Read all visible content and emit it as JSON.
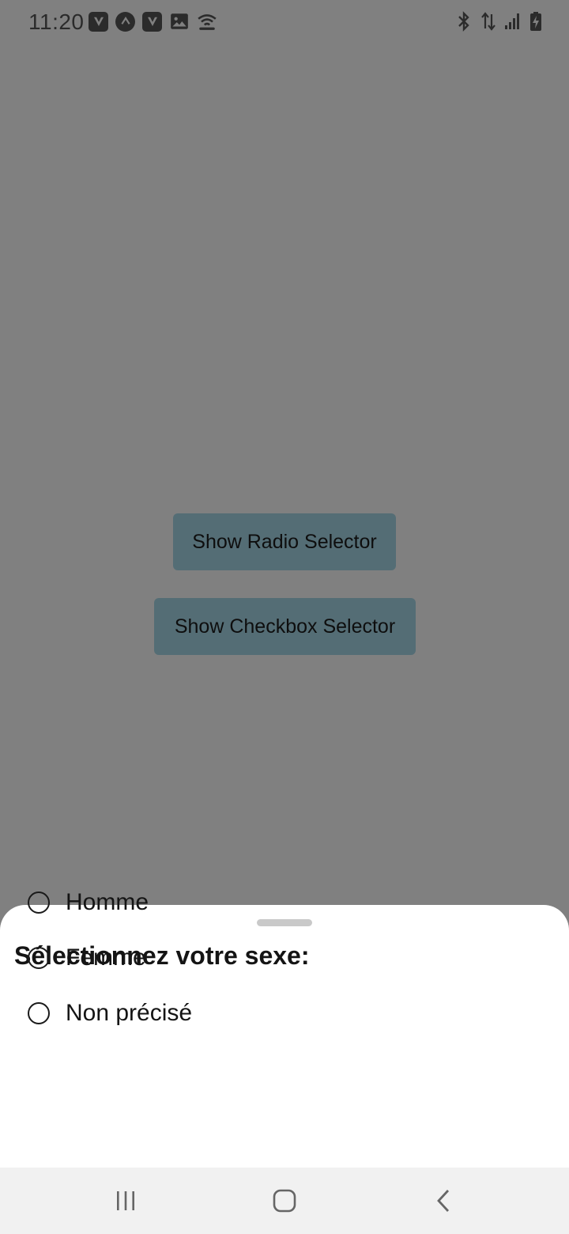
{
  "status_bar": {
    "time": "11:20",
    "left_icons": [
      "v-app-icon",
      "caret-app-icon",
      "v-app-icon",
      "image-icon",
      "wifi-hotspot-icon"
    ],
    "right_icons": [
      "bluetooth-icon",
      "data-transfer-icon",
      "signal-icon",
      "battery-charging-icon"
    ]
  },
  "main": {
    "radio_button_label": "Show Radio Selector",
    "checkbox_button_label": "Show Checkbox Selector"
  },
  "sheet": {
    "title": "Sélectionnez votre sexe:",
    "options": [
      {
        "label": "Homme",
        "selected": false
      },
      {
        "label": "Femme",
        "selected": false
      },
      {
        "label": "Non précisé",
        "selected": false
      }
    ]
  },
  "colors": {
    "scrim": "#808080",
    "button_bg": "#546d75",
    "sheet_bg": "#ffffff",
    "nav_bg": "#f1f1f1"
  }
}
